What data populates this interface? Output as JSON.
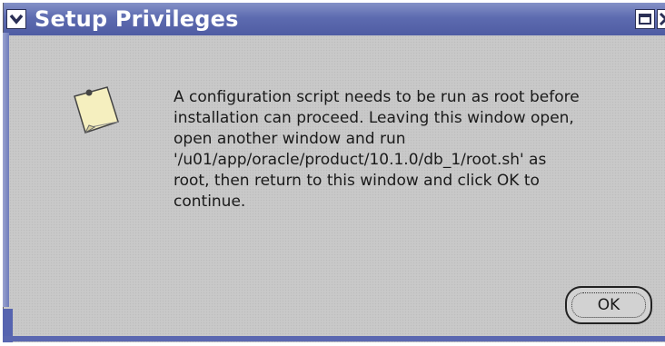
{
  "window": {
    "title": "Setup Privileges"
  },
  "dialog": {
    "message": "A configuration script needs to be run as root before\ninstallation can proceed. Leaving this window open,\nopen another window and run\n'/u01/app/oracle/product/10.1.0/db_1/root.sh' as\nroot, then return to this window and click OK to\ncontinue.",
    "icon": "note-icon",
    "ok_label": "OK"
  },
  "colors": {
    "titlebar": "#5d6bb0",
    "background": "#c9c9c9",
    "note": "#f5efbf"
  }
}
